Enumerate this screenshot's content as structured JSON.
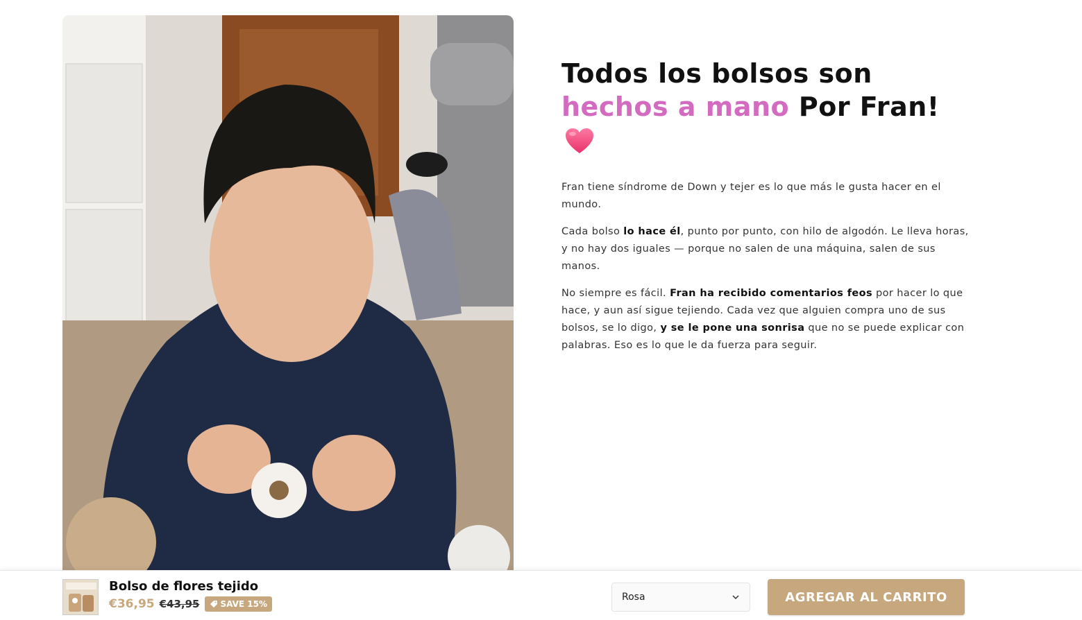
{
  "photo": {
    "alt": "Fran tejiendo una flor de crochet"
  },
  "headline": {
    "line1": "Todos los bolsos son",
    "accent": "hechos a mano",
    "rest": " Por Fran!",
    "heart_icon": "heart-icon",
    "accent_color": "#d36bc0"
  },
  "paragraphs": {
    "p1": "Fran tiene síndrome de Down y tejer es lo que más le gusta hacer en el mundo.",
    "p2_a": "Cada bolso ",
    "p2_b": "lo hace él",
    "p2_c": ", punto por punto, con hilo de algodón. Le lleva horas, y no hay dos iguales — porque no salen de una máquina, salen de sus manos.",
    "p3_a": "No siempre es fácil. ",
    "p3_b": "Fran ha recibido comentarios feos",
    "p3_c": " por hacer lo que hace, y aun así sigue tejiendo. Cada vez que alguien compra uno de sus bolsos, se lo digo, ",
    "p3_d": "y se le pone una sonrisa",
    "p3_e": " que no se puede explicar con palabras. Eso es lo que le da fuerza para seguir."
  },
  "sticky_bar": {
    "product_title": "Bolso de flores tejido",
    "price": "€36,95",
    "compare_price": "€43,95",
    "badge": "SAVE 15%",
    "badge_icon": "tag-icon",
    "variant": "Rosa",
    "add_to_cart": "AGREGAR AL CARRITO",
    "accent_color": "#c7a77d"
  }
}
